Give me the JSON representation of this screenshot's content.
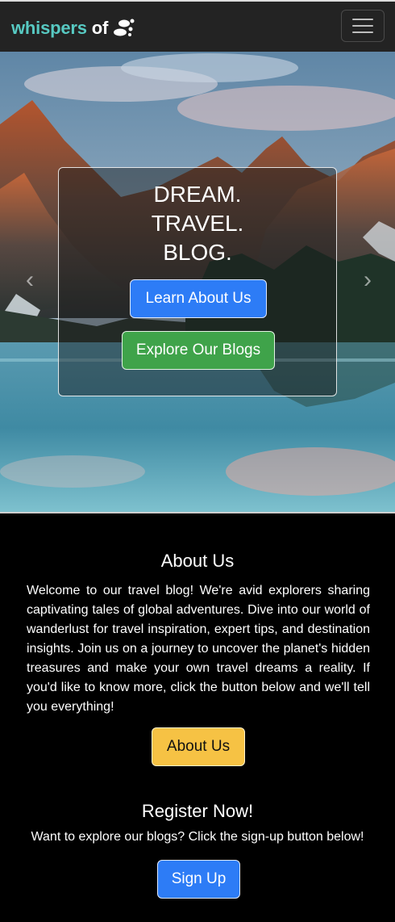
{
  "navbar": {
    "brand_primary": "whispers",
    "brand_secondary": "of",
    "brand_logo_icon": "footprints-icon",
    "menu_icon": "hamburger-menu-icon"
  },
  "hero": {
    "title_lines": [
      "DREAM.",
      "TRAVEL.",
      "BLOG."
    ],
    "learn_button": "Learn About Us",
    "explore_button": "Explore Our Blogs",
    "prev_icon": "chevron-left-icon",
    "next_icon": "chevron-right-icon"
  },
  "about": {
    "heading": "About Us",
    "text": "Welcome to our travel blog! We're avid explorers sharing captivating tales of global adventures. Dive into our world of wanderlust for travel inspiration, expert tips, and destination insights. Join us on a journey to uncover the planet's hidden treasures and make your own travel dreams a reality. If you'd like to know more, click the button below and we'll tell you everything!",
    "button": "About Us"
  },
  "register": {
    "heading": "Register Now!",
    "text": "Want to explore our blogs? Click the sign-up button below!",
    "button": "Sign Up"
  },
  "colors": {
    "brand_teal": "#57c9c2",
    "primary_blue": "#2d7cf6",
    "success_green": "#3fa34a",
    "warning_yellow": "#f6c244",
    "navbar_bg": "#232323"
  }
}
